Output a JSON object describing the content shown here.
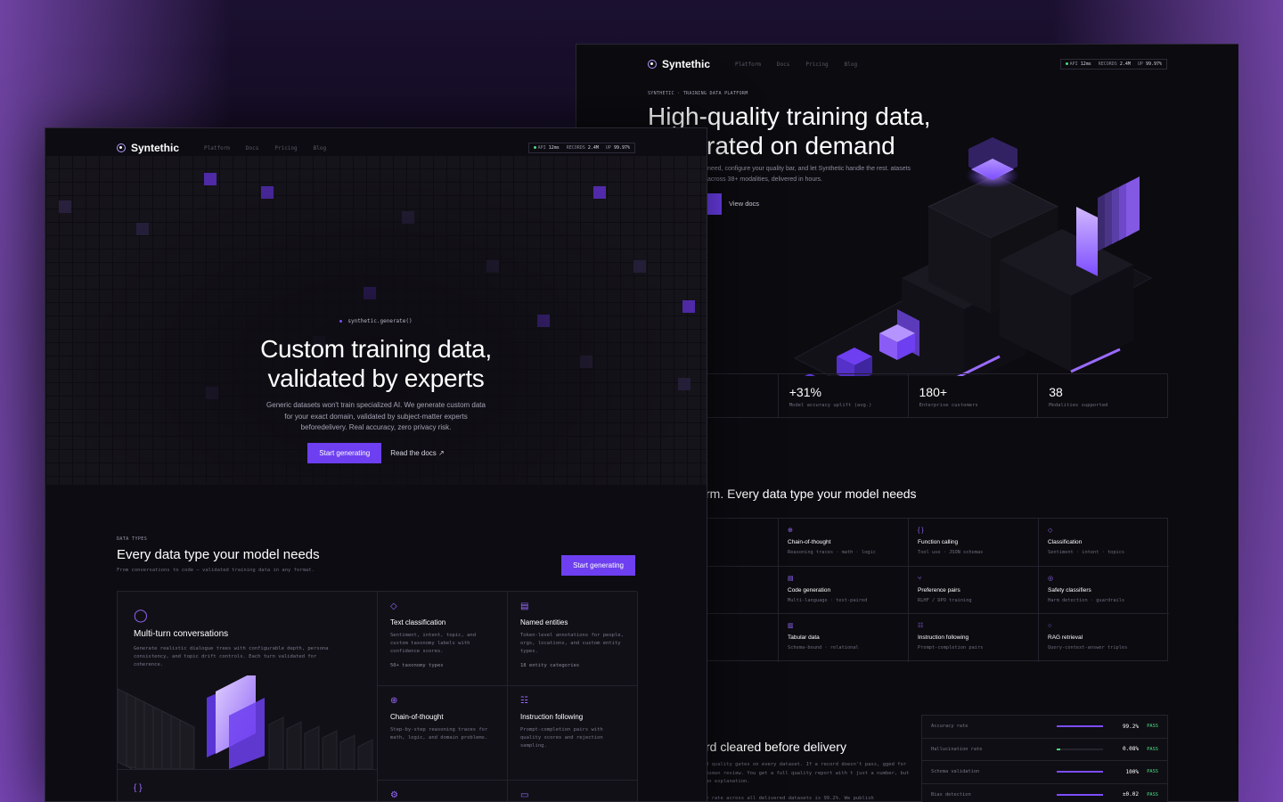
{
  "brand": {
    "name": "Syntethic",
    "accent": "#6d3ff0",
    "pass_color": "#4ade80"
  },
  "nav": {
    "links": [
      "Platform",
      "Docs",
      "Pricing",
      "Blog"
    ]
  },
  "status": {
    "api_label": "API",
    "api_value": "12ms",
    "records_label": "RECORDS",
    "records_value": "2.4M",
    "up_label": "UP",
    "up_value": "99.97%"
  },
  "front": {
    "code_tag": "synthetic.generate()",
    "headline_1": "Custom training data,",
    "headline_2": "validated by experts",
    "lede": "Generic datasets won't train specialized AI. We generate custom data for your exact domain, validated by subject-matter experts beforedelivery. Real accuracy, zero privacy risk.",
    "cta_primary": "Start generating",
    "cta_secondary": "Read the docs ↗",
    "section": {
      "eyebrow": "DATA TYPES",
      "title": "Every data type your model needs",
      "sub": "From conversations to code — validated training data in any format.",
      "cta": "Start generating"
    },
    "big_card": {
      "title": "Multi-turn conversations",
      "desc": "Generate realistic dialogue trees with configurable depth, persona consistency, and topic drift controls. Each turn validated for coherence.",
      "icon": "chat-bubble-icon"
    },
    "cards": [
      {
        "icon": "tag-icon",
        "glyph": "◇",
        "title": "Text classification",
        "desc": "Sentiment, intent, topic, and custom taxonomy labels with confidence scores.",
        "meta": "50+ taxonomy types"
      },
      {
        "icon": "document-icon",
        "glyph": "▤",
        "title": "Named entities",
        "desc": "Token-level annotations for people, orgs, locations, and custom entity types.",
        "meta": "18 entity categories"
      },
      {
        "icon": "brain-icon",
        "glyph": "⊕",
        "title": "Chain-of-thought",
        "desc": "Step-by-step reasoning traces for math, logic, and domain problems.",
        "meta": ""
      },
      {
        "icon": "list-icon",
        "glyph": "☷",
        "title": "Instruction following",
        "desc": "Prompt-completion pairs with quality scores and rejection sampling.",
        "meta": ""
      }
    ],
    "bottom_icons": [
      "{ }",
      "⚙",
      "▭"
    ]
  },
  "back": {
    "eyebrow": "SYNTHETIC · TRAINING DATA PLATFORM",
    "headline_1": "High-quality training data,",
    "headline_2": "rated on demand",
    "lede": "need, configure your quality bar, and let Synthetic handle the rest. atasets across 38+ modalities, delivered in hours.",
    "view_docs": "View docs",
    "stats": [
      {
        "value": "",
        "label": "d since 2021"
      },
      {
        "value": "+31%",
        "label": "Model accuracy uplift (avg.)"
      },
      {
        "value": "180+",
        "label": "Enterprise customers"
      },
      {
        "value": "38",
        "label": "Modalities supported"
      }
    ],
    "section_title": "rm. Every data type your model needs",
    "table": [
      {
        "glyph": "",
        "title": "ations",
        "desc": "persona config"
      },
      {
        "glyph": "⊕",
        "title": "Chain-of-thought",
        "desc": "Reasoning traces · math · logic"
      },
      {
        "glyph": "{ }",
        "title": "Function calling",
        "desc": "Tool use · JSON schemas"
      },
      {
        "glyph": "◇",
        "title": "Classification",
        "desc": "Sentiment · intent · topics"
      },
      {
        "glyph": "",
        "title": "",
        "desc": "aligned pairs"
      },
      {
        "glyph": "▤",
        "title": "Code generation",
        "desc": "Multi-language · test-paired"
      },
      {
        "glyph": "⑂",
        "title": "Preference pairs",
        "desc": "RLHF / DPO training"
      },
      {
        "glyph": "◎",
        "title": "Safety classifiers",
        "desc": "Harm detection · guardrails"
      },
      {
        "glyph": "",
        "title": "",
        "desc": "urced"
      },
      {
        "glyph": "▥",
        "title": "Tabular data",
        "desc": "Schema-bound · relational"
      },
      {
        "glyph": "☷",
        "title": "Instruction following",
        "desc": "Prompt-completion pairs"
      },
      {
        "glyph": "○",
        "title": "RAG retrieval",
        "desc": "Query-context-answer triples"
      }
    ],
    "quality_title": "rd cleared before delivery",
    "quality_desc": "d quality gates on every dataset. If a record doesn't pass, gged for human review. You get a full quality report with t just a number, but an explanation.",
    "quality_desc_2": "y rate across all delivered datasets is 99.2%. We publish",
    "quality": [
      {
        "label": "Accuracy rate",
        "value": "99.2%",
        "fill": 0.992,
        "status": "PASS"
      },
      {
        "label": "Hallucination rate",
        "value": "0.08%",
        "fill": 0.08,
        "status": "PASS"
      },
      {
        "label": "Schema validation",
        "value": "100%",
        "fill": 1.0,
        "status": "PASS"
      },
      {
        "label": "Bias detection",
        "value": "±0.02",
        "fill": 1.0,
        "status": "PASS"
      }
    ]
  }
}
